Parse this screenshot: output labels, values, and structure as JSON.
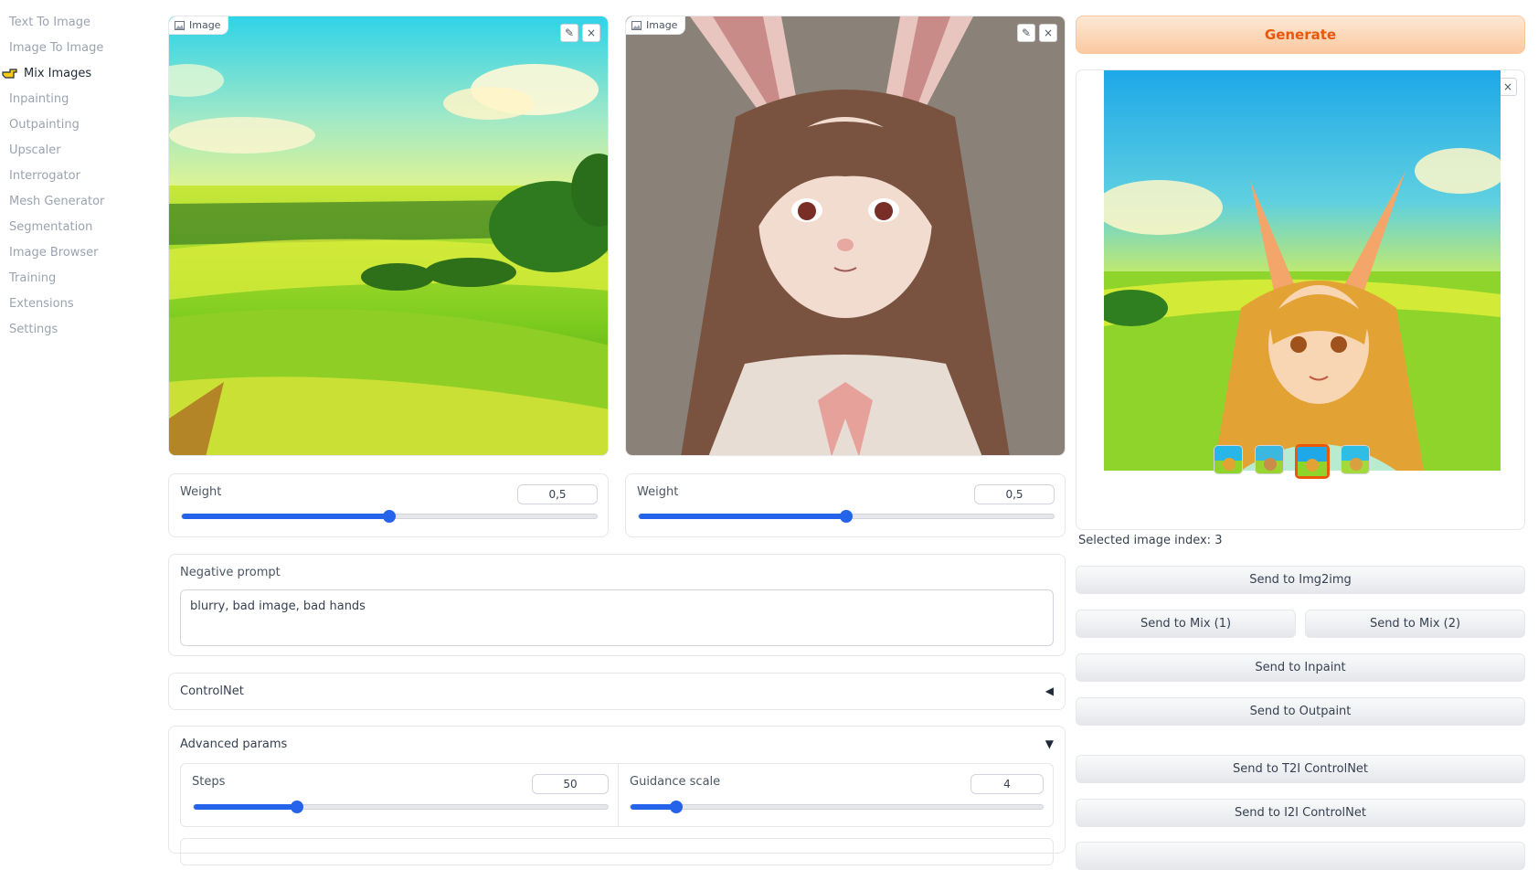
{
  "sidebar": {
    "items": [
      {
        "label": "Text To Image",
        "active": false
      },
      {
        "label": "Image To Image",
        "active": false
      },
      {
        "label": "Mix Images",
        "active": true
      },
      {
        "label": "Inpainting",
        "active": false
      },
      {
        "label": "Outpainting",
        "active": false
      },
      {
        "label": "Upscaler",
        "active": false
      },
      {
        "label": "Interrogator",
        "active": false
      },
      {
        "label": "Mesh Generator",
        "active": false
      },
      {
        "label": "Segmentation",
        "active": false
      },
      {
        "label": "Image Browser",
        "active": false
      },
      {
        "label": "Training",
        "active": false
      },
      {
        "label": "Extensions",
        "active": false
      },
      {
        "label": "Settings",
        "active": false
      }
    ]
  },
  "image1": {
    "label": "Image",
    "weight_label": "Weight",
    "weight_value": "0,5",
    "weight_fraction": 0.5
  },
  "image2": {
    "label": "Image",
    "weight_label": "Weight",
    "weight_value": "0,5",
    "weight_fraction": 0.5
  },
  "negative_prompt": {
    "label": "Negative prompt",
    "value": "blurry, bad image, bad hands"
  },
  "controlnet": {
    "label": "ControlNet",
    "arrow": "◀"
  },
  "advanced": {
    "label": "Advanced params",
    "arrow": "▼",
    "steps": {
      "label": "Steps",
      "value": "50",
      "fraction": 0.25
    },
    "guidance": {
      "label": "Guidance scale",
      "value": "4",
      "fraction": 0.11
    }
  },
  "output": {
    "generate_label": "Generate",
    "selected_index_text": "Selected image index: 3",
    "thumbnail_count": 4,
    "selected_thumbnail": 3
  },
  "actions": {
    "send_img2img": "Send to Img2img",
    "send_mix1": "Send to Mix (1)",
    "send_mix2": "Send to Mix (2)",
    "send_inpaint": "Send to Inpaint",
    "send_outpaint": "Send to Outpaint",
    "send_t2i_controlnet": "Send to T2I ControlNet",
    "send_i2i_controlnet": "Send to I2I ControlNet"
  },
  "colors": {
    "accent": "#2563eb",
    "generate": "#ea580c",
    "sidebar_muted": "#9ca3af"
  }
}
